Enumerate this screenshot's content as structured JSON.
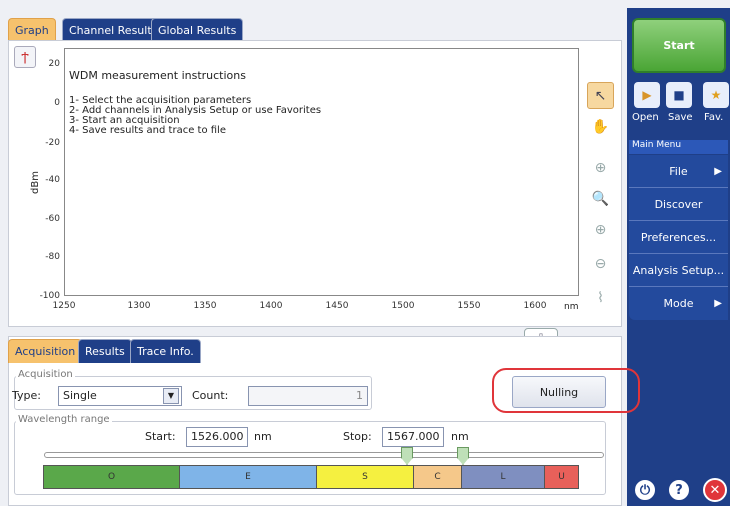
{
  "tabs": {
    "graph": "Graph",
    "channel_results": "Channel Results",
    "global_results": "Global Results"
  },
  "graph": {
    "instructions_title": "WDM measurement instructions",
    "instructions": [
      "1- Select the acquisition parameters",
      "2- Add channels in Analysis Setup or use Favorites",
      "3- Start an acquisition",
      "4- Save results and trace to file"
    ],
    "y_axis_label": "dBm",
    "y_ticks": [
      "20",
      "0",
      "-20",
      "-40",
      "-60",
      "-80",
      "-100"
    ],
    "x_ticks": [
      "1250",
      "1300",
      "1350",
      "1400",
      "1450",
      "1500",
      "1550",
      "1600"
    ],
    "x_unit": "nm"
  },
  "right_panel": {
    "start": "Start",
    "quick": [
      "Open",
      "Save",
      "Fav."
    ],
    "main_menu": "Main Menu",
    "items": [
      "File",
      "Discover",
      "Preferences...",
      "Analysis Setup...",
      "Mode"
    ]
  },
  "bottom_tabs": {
    "acquisition": "Acquisition",
    "results": "Results",
    "trace_info": "Trace Info."
  },
  "acquisition": {
    "group_label": "Acquisition",
    "type_label": "Type:",
    "type_value": "Single",
    "count_label": "Count:",
    "count_value": "1",
    "nulling": "Nulling"
  },
  "wavelength": {
    "group_label": "Wavelength range",
    "start_label": "Start:",
    "start_value": "1526.000",
    "start_unit": "nm",
    "stop_label": "Stop:",
    "stop_value": "1567.000",
    "stop_unit": "nm",
    "bands": [
      "O",
      "E",
      "S",
      "C",
      "L",
      "U"
    ],
    "band_colors": [
      "#5aa84a",
      "#7fb4e8",
      "#f5f040",
      "#f5c88a",
      "#7f8fc0",
      "#e8605a"
    ]
  }
}
